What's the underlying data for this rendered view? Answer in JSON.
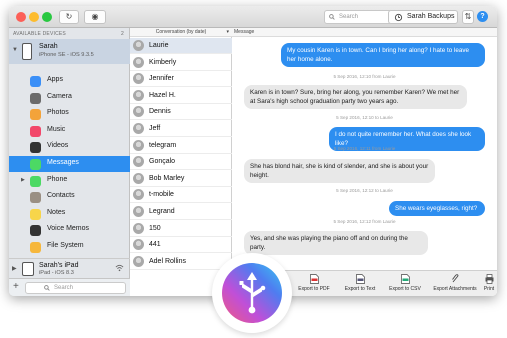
{
  "toolbar": {
    "search_placeholder": "Search",
    "backups_label": "Sarah Backups"
  },
  "sidebar": {
    "section_title": "AVAILABLE DEVICES",
    "count": "2",
    "device": {
      "name": "Sarah",
      "model": "iPhone SE - iOS 9.3.5"
    },
    "items": [
      {
        "label": "Apps",
        "color": "#3a8ff7"
      },
      {
        "label": "Camera",
        "color": "#6b6b6b"
      },
      {
        "label": "Photos",
        "color": "#f3a33a"
      },
      {
        "label": "Music",
        "color": "#f2476a"
      },
      {
        "label": "Videos",
        "color": "#333333"
      },
      {
        "label": "Messages",
        "color": "#4cd964"
      },
      {
        "label": "Phone",
        "color": "#4cd964"
      },
      {
        "label": "Contacts",
        "color": "#9a8f83"
      },
      {
        "label": "Notes",
        "color": "#f7d54a"
      },
      {
        "label": "Voice Memos",
        "color": "#333333"
      },
      {
        "label": "File System",
        "color": "#f6b73c"
      }
    ],
    "device2": {
      "name": "Sarah's iPad",
      "model": "iPad - iOS 8.3"
    },
    "search_placeholder": "Search",
    "add_label": "+",
    "selected_color": "#2d8ef0"
  },
  "conversations": {
    "header": "Conversation (by date)",
    "items": [
      "Laurie",
      "Kimberly",
      "Jennifer",
      "Hazel H.",
      "Dennis",
      "Jeff",
      "telegram",
      "Gonçalo",
      "Bob      Marley",
      "t-mobile",
      "Legrand",
      "150",
      "441",
      "Adel      Rollins"
    ]
  },
  "messages": {
    "header": "Message",
    "items": [
      {
        "dir": "out",
        "text": "My cousin Karen is in town. Can I bring her along? I hate to leave her home alone."
      },
      {
        "stamp": "5 Sep 2016, 12:10 from Laurie"
      },
      {
        "dir": "in",
        "text": "Karen is in town? Sure, bring her along, you remember Karen? We met her at Sara's high school graduation party two years ago."
      },
      {
        "stamp": "5 Sep 2016, 12:10 to Laurie"
      },
      {
        "dir": "out",
        "text": "I do not quite remember her. What does she look like?"
      },
      {
        "stamp": "5 Sep 2016, 12:11 from Laurie"
      },
      {
        "dir": "in",
        "text": "She has blond hair, she is kind of slender, and she is about your height."
      },
      {
        "stamp": "5 Sep 2016, 12:12 to Laurie"
      },
      {
        "dir": "out",
        "text": "She wears eyeglasses, right?"
      },
      {
        "stamp": "5 Sep 2016, 12:12 from Laurie"
      },
      {
        "dir": "in",
        "text": "Yes, and she was playing the piano off and on during the party."
      }
    ]
  },
  "bottom_actions": [
    "Export to PDF",
    "Export to Text",
    "Export to CSV",
    "Export Attachments",
    "Print"
  ]
}
